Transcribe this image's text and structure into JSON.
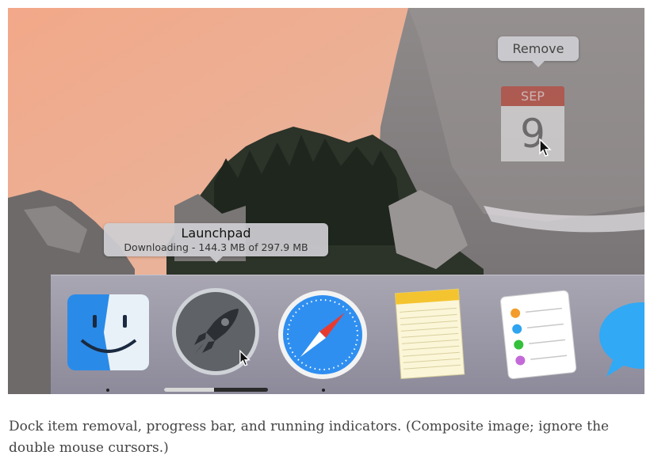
{
  "tooltips": {
    "remove": "Remove",
    "launchpad_title": "Launchpad",
    "launchpad_status": "Downloading - 144.3 MB of 297.9 MB"
  },
  "calendar_ghost": {
    "month": "SEP",
    "day": "9"
  },
  "dock": {
    "apps": [
      {
        "name": "Finder",
        "icon": "finder-icon",
        "running": true
      },
      {
        "name": "Launchpad",
        "icon": "launchpad-rocket-icon",
        "running": false,
        "downloading": true
      },
      {
        "name": "Safari",
        "icon": "safari-compass-icon",
        "running": true
      },
      {
        "name": "Notes",
        "icon": "notes-icon",
        "running": false
      },
      {
        "name": "Reminders",
        "icon": "reminders-icon",
        "running": false
      },
      {
        "name": "Messages",
        "icon": "messages-bubble-icon",
        "running": false
      }
    ],
    "download_progress": 0.48
  },
  "caption": "Dock item removal, progress bar, and running indicators. (Composite image; ignore the double mouse cursors.)"
}
